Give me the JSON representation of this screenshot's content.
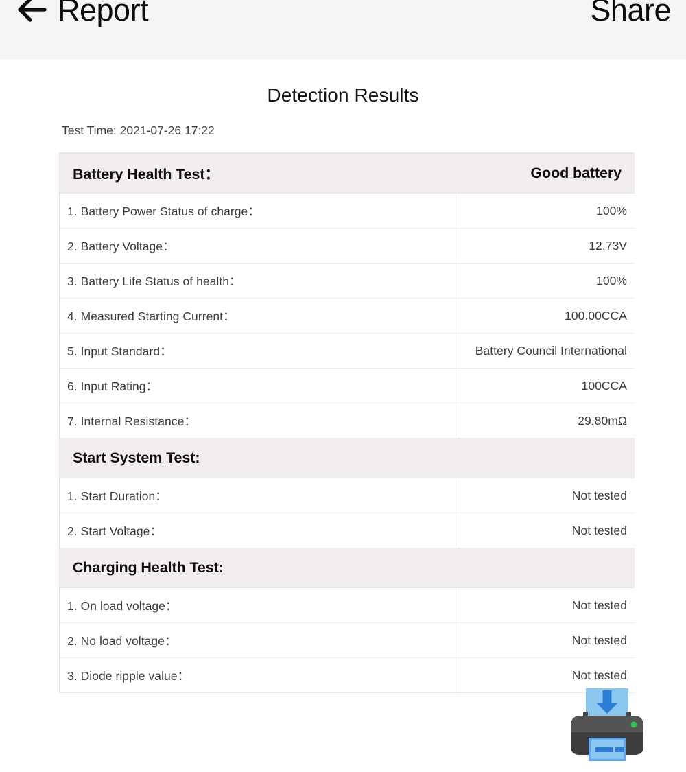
{
  "appbar": {
    "back_icon": "back-arrow-icon",
    "title": "Report",
    "share_label": "Share"
  },
  "report": {
    "page_title": "Detection Results",
    "test_time": "Test Time: 2021-07-26 17:22",
    "sections": [
      {
        "title": "Battery Health Test：",
        "status": "Good battery",
        "rows": [
          {
            "label": "1. Battery Power Status of charge：",
            "value": "100%"
          },
          {
            "label": "2. Battery Voltage：",
            "value": "12.73V"
          },
          {
            "label": "3. Battery Life Status of health：",
            "value": "100%"
          },
          {
            "label": "4. Measured Starting Current：",
            "value": "100.00CCA"
          },
          {
            "label": "5. Input Standard：",
            "value": "Battery Council International"
          },
          {
            "label": "6. Input Rating：",
            "value": "100CCA"
          },
          {
            "label": "7. Internal Resistance：",
            "value": "29.80mΩ"
          }
        ]
      },
      {
        "title": "Start System Test:",
        "status": "",
        "rows": [
          {
            "label": "1. Start Duration：",
            "value": "Not tested"
          },
          {
            "label": "2. Start Voltage：",
            "value": "Not tested"
          }
        ]
      },
      {
        "title": "Charging Health Test:",
        "status": "",
        "rows": [
          {
            "label": "1. On load voltage：",
            "value": "Not tested"
          },
          {
            "label": "2. No load voltage：",
            "value": "Not tested"
          },
          {
            "label": "3. Diode ripple value：",
            "value": "Not tested"
          }
        ]
      }
    ]
  },
  "actions": {
    "print_icon": "printer-save-icon"
  },
  "colors": {
    "appbar_bg": "#f4f4f4",
    "section_bg": "#f2eef0",
    "border": "#e6e6e6",
    "row_border": "#ececec",
    "text_primary": "#0f0f0f",
    "text_secondary": "#3c3c3c",
    "printer_body": "#4a4a4a",
    "printer_paper": "#8cc7f0",
    "printer_arrow": "#2a7fd4",
    "printer_led": "#2cc44a"
  }
}
